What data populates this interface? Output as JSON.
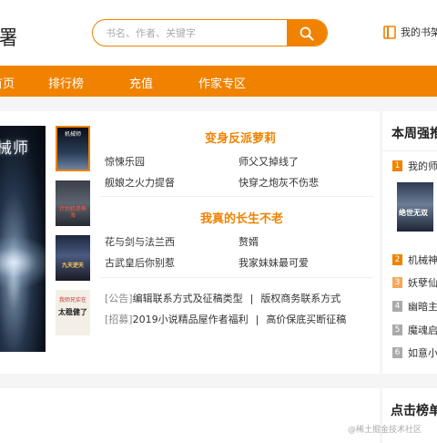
{
  "header": {
    "logo_text": "署",
    "search_placeholder": "书名、作者、关键字",
    "shelf_label": "我的书架"
  },
  "nav": {
    "items": [
      "首页",
      "排行榜",
      "充值",
      "作家专区"
    ]
  },
  "featured": {
    "big_cover_text": "械师",
    "thumbs": [
      {
        "title": "机械师"
      },
      {
        "title": "计算机 恐怖海"
      },
      {
        "title": "天庭逆天"
      },
      {
        "title": "我师兄实在太稳健了"
      }
    ],
    "thumb_top_text": [
      "机械师",
      "计划机恐怖海",
      "九天逆天",
      "我师兄实在"
    ],
    "thumb_bottom_text": "太稳健了",
    "block1": {
      "title": "变身反派萝莉",
      "links": [
        "惊悚乐园",
        "师父又掉线了",
        "舰娘之火力提督",
        "快穿之炮灰不伤悲"
      ]
    },
    "block2": {
      "title": "我真的长生不老",
      "links": [
        "花与剑与法兰西",
        "赘婿",
        "古武皇后你别惹",
        "我家妹妹最可爱"
      ]
    },
    "notices": [
      {
        "tag": "[公告]",
        "left": "编辑联系方式及征稿类型",
        "sep": "|",
        "right": "版权商务联系方式"
      },
      {
        "tag": "[招募]",
        "left": "2019小说精品屋作者福利",
        "sep": "|",
        "right": "高价保底买断征稿"
      }
    ]
  },
  "weekly_rank": {
    "title": "本周强推",
    "items": [
      {
        "num": "1",
        "name": "我的师兄",
        "color": "#f08200"
      },
      {
        "num": "2",
        "name": "机械神",
        "color": "#f08200"
      },
      {
        "num": "3",
        "name": "妖孽仙",
        "color": "#f6a85a"
      },
      {
        "num": "4",
        "name": "幽暗主",
        "color": "#999999"
      },
      {
        "num": "5",
        "name": "魔魂启",
        "color": "#999999"
      },
      {
        "num": "6",
        "name": "如意小",
        "color": "#999999"
      }
    ],
    "cover_text": "绝世无双"
  },
  "click_rank": {
    "title": "点击榜单"
  },
  "watermark": "@稀土掘金技术社区",
  "colors": {
    "accent": "#f08200",
    "background": "#f5f5f5"
  }
}
